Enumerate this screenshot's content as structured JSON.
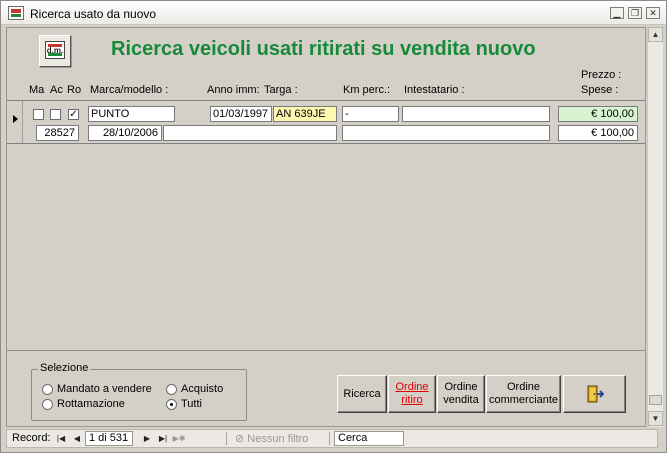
{
  "window": {
    "title": "Ricerca usato da nuovo",
    "controls": [
      "minimize-icon",
      "restore-icon",
      "close-icon"
    ]
  },
  "header": {
    "logo_text": "d.m.",
    "title": "Ricerca veicoli usati ritirati su vendita nuovo",
    "title_color": "#178a3a",
    "columns": {
      "ma": "Ma",
      "ac": "Ac",
      "ro": "Ro",
      "marca": "Marca/modello :",
      "anno": "Anno imm:",
      "targa": "Targa :",
      "km": "Km perc.:",
      "intestatario": "Intestatario :",
      "prezzo": "Prezzo :",
      "spese": "Spese :"
    }
  },
  "record": {
    "mandato_checked": false,
    "acquisto_checked": false,
    "ritiro_checked": true,
    "marca_modello": "PUNTO",
    "anno_imm": "01/03/1997",
    "targa": "AN 639JE",
    "km_perc": "-",
    "intestatario": "",
    "prezzo": "€ 100,00",
    "codice": "28527",
    "data": "28/10/2006",
    "descrizione": "",
    "note": "",
    "spese": "€ 100,00",
    "colors": {
      "targa_bg": "#fff8b0",
      "prezzo_bg": "#d7f3d2"
    }
  },
  "selezione": {
    "label": "Selezione",
    "options": [
      {
        "label": "Mandato a vendere",
        "selected": false
      },
      {
        "label": "Acquisto",
        "selected": false
      },
      {
        "label": "Rottamazione",
        "selected": false
      },
      {
        "label": "Tutti",
        "selected": true
      }
    ]
  },
  "buttons": {
    "ricerca": "Ricerca",
    "ordine_ritiro": "Ordine ritiro",
    "ordine_vendita": "Ordine vendita",
    "ordine_commerciante": "Ordine commerciante",
    "exit_icon": "exit-door-icon"
  },
  "navigator": {
    "record_label": "Record:",
    "position": "1 di 531",
    "filter": "Nessun filtro",
    "search_value": "Cerca"
  }
}
